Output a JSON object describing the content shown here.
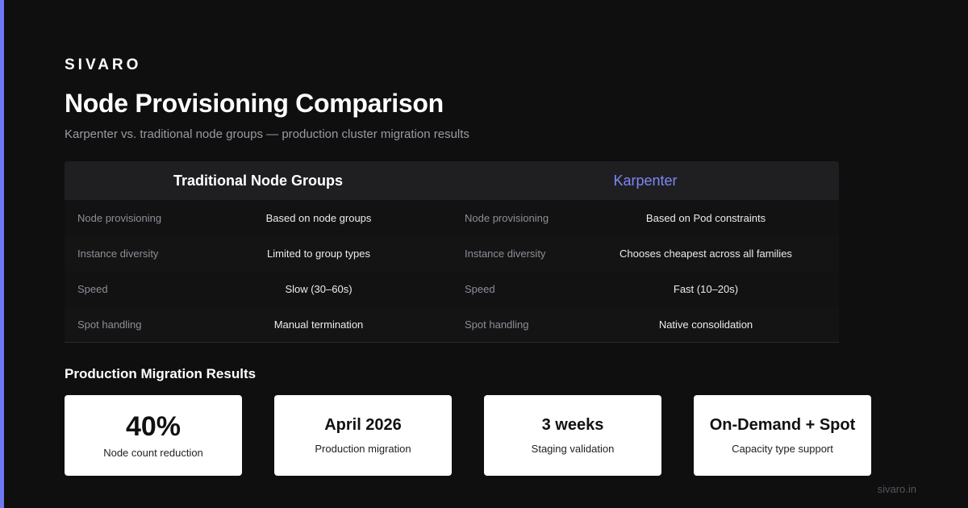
{
  "brand": "SIVARO",
  "title": "Node Provisioning Comparison",
  "subtitle": "Karpenter vs. traditional node groups — production cluster migration results",
  "accent_color": "#6e78f0",
  "comparison": {
    "left": {
      "header": "Traditional Node Groups",
      "rows": [
        {
          "label": "Node provisioning",
          "value": "Based on node groups"
        },
        {
          "label": "Instance diversity",
          "value": "Limited to group types"
        },
        {
          "label": "Speed",
          "value": "Slow (30–60s)"
        },
        {
          "label": "Spot handling",
          "value": "Manual termination"
        }
      ]
    },
    "right": {
      "header": "Karpenter",
      "rows": [
        {
          "label": "Node provisioning",
          "value": "Based on Pod constraints"
        },
        {
          "label": "Instance diversity",
          "value": "Chooses cheapest across all families"
        },
        {
          "label": "Speed",
          "value": "Fast (10–20s)"
        },
        {
          "label": "Spot handling",
          "value": "Native consolidation"
        }
      ]
    }
  },
  "results": {
    "title": "Production Migration Results",
    "cards": [
      {
        "value": "40%",
        "label": "Node count reduction"
      },
      {
        "value": "April 2026",
        "label": "Production migration"
      },
      {
        "value": "3 weeks",
        "label": "Staging validation"
      },
      {
        "value": "On-Demand + Spot",
        "label": "Capacity type support"
      }
    ]
  },
  "footer": "sivaro.in"
}
